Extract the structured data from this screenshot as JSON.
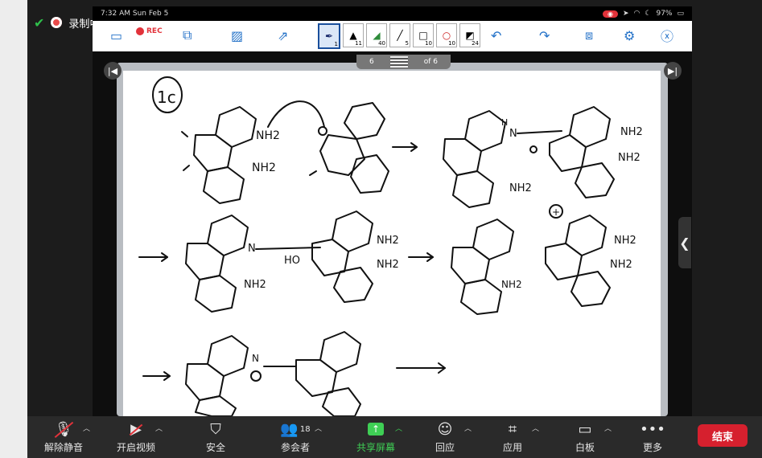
{
  "zoom_rec": {
    "title": "录制中...",
    "pause_icon": "pause-icon",
    "stop_icon": "stop-icon"
  },
  "ipad_status": {
    "time": "7:32 AM   Sun Feb 5",
    "battery": "97%"
  },
  "app_toolbar": {
    "rec_label": "REC",
    "pens": [
      {
        "num": "1",
        "color": "#1a2a6c",
        "selected": true
      },
      {
        "num": "11",
        "color": "#111111"
      },
      {
        "num": "40",
        "color": "#2e8b3a"
      },
      {
        "num": "5",
        "color": "#111111"
      },
      {
        "num": "10",
        "color": "#111111"
      },
      {
        "num": "10",
        "color": "#cc2222"
      },
      {
        "num": "24",
        "color": "#111111"
      }
    ]
  },
  "page_indicator": {
    "current": "6",
    "total_label": "of 6"
  },
  "handwriting": {
    "label_1c": "1c",
    "nh2": "NH2",
    "n_h": "H",
    "ho": "HO",
    "n": "N",
    "plus": "+"
  },
  "bottom_bar": {
    "items": [
      {
        "label": "解除静音",
        "icon": "muted-mic-icon"
      },
      {
        "label": "开启视频",
        "icon": "video-off-icon"
      },
      {
        "label": "安全",
        "icon": "shield-icon"
      },
      {
        "label": "参会者",
        "icon": "participants-icon",
        "count": "18"
      },
      {
        "label": "共享屏幕",
        "icon": "share-screen-icon"
      },
      {
        "label": "回应",
        "icon": "reaction-icon"
      },
      {
        "label": "应用",
        "icon": "apps-icon"
      },
      {
        "label": "白板",
        "icon": "whiteboard-icon"
      },
      {
        "label": "更多",
        "icon": "more-icon"
      }
    ],
    "end_label": "结束"
  },
  "colors": {
    "share_green": "#3fcf55",
    "end_red": "#d6202e",
    "toolbar_blue": "#2472c8"
  }
}
